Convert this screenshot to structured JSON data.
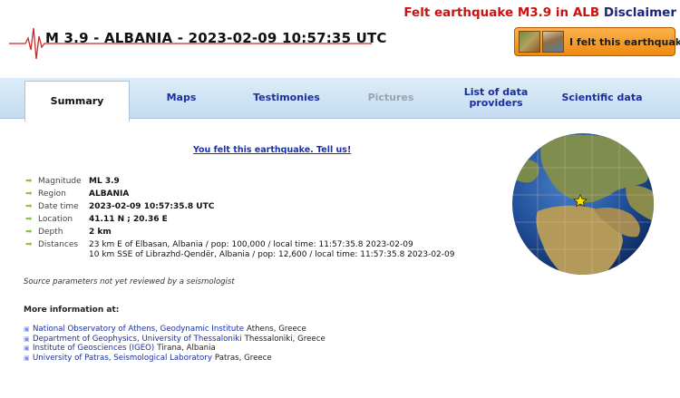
{
  "header": {
    "felt_title": "Felt earthquake M3.9 in ALB",
    "disclaimer": "Disclaimer",
    "event_title": "M 3.9 - ALBANIA - 2023-02-09 10:57:35 UTC",
    "felt_button": "I felt this earthquake"
  },
  "tabs": [
    {
      "label": "Summary",
      "state": "active"
    },
    {
      "label": "Maps",
      "state": "normal"
    },
    {
      "label": "Testimonies",
      "state": "normal"
    },
    {
      "label": "Pictures",
      "state": "disabled"
    },
    {
      "label": "List of data providers",
      "state": "normal"
    },
    {
      "label": "Scientific data",
      "state": "normal"
    }
  ],
  "tell_us": "You felt this earthquake. Tell us!",
  "params": {
    "magnitude": {
      "label": "Magnitude",
      "value": "ML 3.9"
    },
    "region": {
      "label": "Region",
      "value": "ALBANIA"
    },
    "datetime": {
      "label": "Date time",
      "value": "2023-02-09 10:57:35.8 UTC"
    },
    "location": {
      "label": "Location",
      "value": "41.11 N ; 20.36 E"
    },
    "depth": {
      "label": "Depth",
      "value": "2 km"
    },
    "distances": {
      "label": "Distances",
      "lines": [
        "23 km E of Elbasan, Albania / pop: 100,000 / local time: 11:57:35.8 2023-02-09",
        "10 km SSE of Librazhd-Qendër, Albania / pop: 12,600 / local time: 11:57:35.8 2023-02-09"
      ]
    }
  },
  "review_note": "Source parameters not yet reviewed by a seismologist",
  "more_info_title": "More information at:",
  "more_info": [
    {
      "org": "National Observatory of Athens, Geodynamic Institute",
      "loc": "Athens, Greece"
    },
    {
      "org": "Department of Geophysics, University of Thessaloniki",
      "loc": "Thessaloniki, Greece"
    },
    {
      "org": "Institute of Geosciences (IGEO)",
      "loc": "Tirana, Albania"
    },
    {
      "org": "University of Patras, Seismological Laboratory",
      "loc": "Patras, Greece"
    }
  ],
  "icons": {
    "param_arrow": "arrow-right-icon",
    "link_bullet": "bullet-icon",
    "epicenter": "star-icon"
  },
  "colors": {
    "felt_title": "#cc1111",
    "tab_link": "#1b2ea0",
    "button_orange": "#ef8a12",
    "arrow_green": "#8bc34a"
  }
}
